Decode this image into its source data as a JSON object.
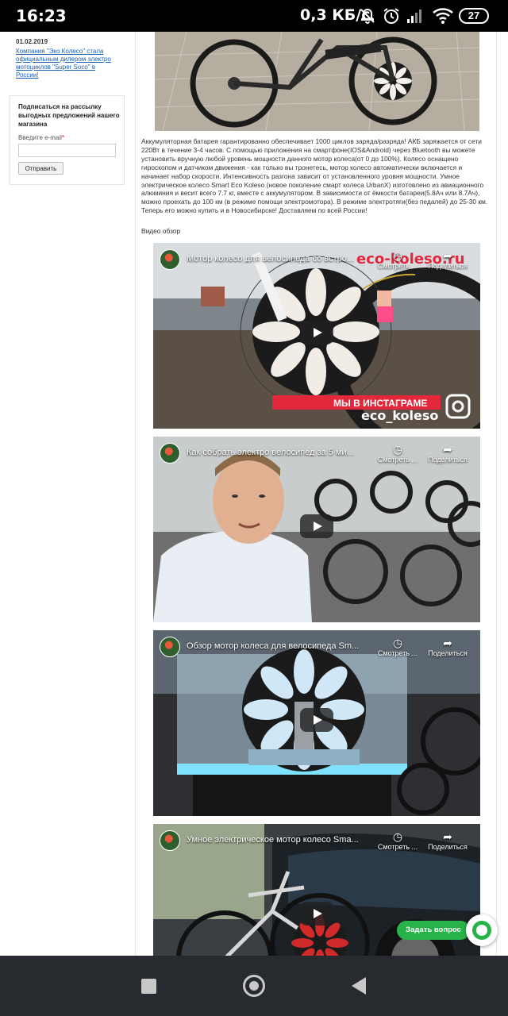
{
  "status_bar": {
    "time": "16:23",
    "net_speed": "0,3 КБ/с",
    "battery": "27",
    "icons": [
      "bell-off-icon",
      "alarm-icon",
      "signal-icon",
      "wifi-icon",
      "battery-icon"
    ]
  },
  "sidebar": {
    "news": {
      "date": "01.02.2019",
      "link": "Компания \"Эко Колесо\" стала официальным дилером электро мотоциклов \"Super Soco\" в России!"
    },
    "subscribe": {
      "title": "Подписаться на рассылку выгодных предложений нашего магазина",
      "email_label": "Введите e-mail",
      "email_required_mark": "*",
      "email_value": "",
      "submit_label": "Отправить"
    }
  },
  "article": {
    "text": "Аккумуляторная батарея гарантированно обеспечивает 1000 циклов заряда/разряда! АКБ заряжается от сети 220Вт в течение 3-4 часов. С помощью приложения на смартфоне(IOS&Android) через Bluetooth вы можете установить вручную любой уровень мощности данного мотор колеса(от 0 до 100%). Колесо оснащено гироскопом и датчиком движения - как только вы тронетесь, мотор колесо автоматически включается и начинает набор скорости. Интенсивность разгона зависит от установленного уровня мощности. Умное электрическое колесо Smart Eco Koleso (новое поколение смарт колеса UrbanX) изготовлено из авиационного алюминия и весит всего 7.7 кг, вместе с аккумулятором. В зависимости от ёмкости батареи(5.8Ач или 8.7Ач), можно проехать до 100 км (в режиме помощи электромотора). В режиме электротяги(без педалей) до 25-30 км. Теперь его можно купить и в Новосибирске! Доставляем по всей России!",
    "video_label": "Видео обзор"
  },
  "videos": [
    {
      "title": "Мотор колесо для велосипеда со встро...",
      "watch_later": "Смотреть ...",
      "share": "Поделиться",
      "overlay_banner": "МЫ В ИНСТАГРАМЕ",
      "overlay_handle": "eco_koleso",
      "overlay_site": "eco-koleso.ru"
    },
    {
      "title": "Как собрать электро велосипед за 5 ми...",
      "watch_later": "Смотреть ...",
      "share": "Поделиться"
    },
    {
      "title": "Обзор мотор колеса для велосипеда Sm...",
      "watch_later": "Смотреть ...",
      "share": "Поделиться"
    },
    {
      "title": "Умное электрическое мотор колесо Sma...",
      "watch_later": "Смотреть ...",
      "share": "Поделиться"
    }
  ],
  "widgets": {
    "ask_question": "Задать вопрос"
  },
  "colors": {
    "accent_green": "#27b34a",
    "link_blue": "#1a5fb4",
    "wheel_red": "#d12a2a"
  }
}
